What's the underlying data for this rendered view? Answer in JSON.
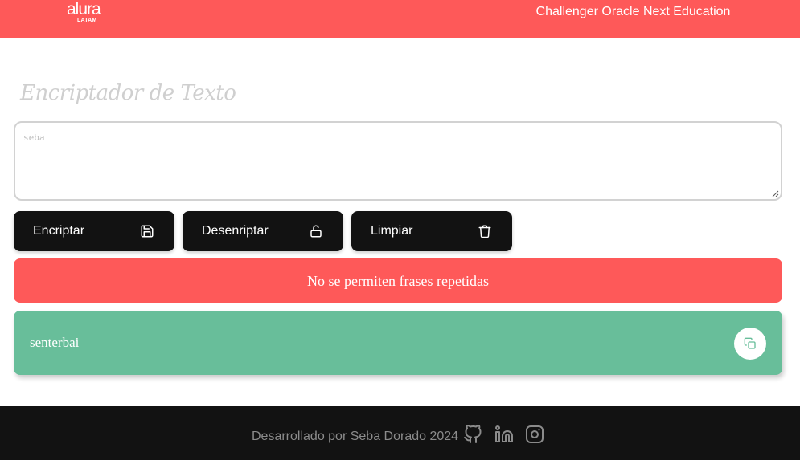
{
  "header": {
    "logo_text": "alura",
    "logo_sub": "LATAM",
    "title": "Challenger Oracle Next Education"
  },
  "main": {
    "title": "Encriptador de Texto",
    "input_value": "seba",
    "buttons": [
      {
        "label": "Encriptar",
        "icon": "save-icon"
      },
      {
        "label": "Desenriptar",
        "icon": "unlock-icon"
      },
      {
        "label": "Limpiar",
        "icon": "trash-icon"
      }
    ],
    "alert": "No se permiten frases repetidas",
    "result": {
      "text": "senterbai",
      "copy_icon": "copy-icon"
    }
  },
  "footer": {
    "credit": "Desarrollado por Seba Dorado 2024",
    "social_icons": [
      "github-icon",
      "linkedin-icon",
      "instagram-icon"
    ]
  },
  "colors": {
    "accent_red": "#fe5959",
    "dark": "#121212",
    "success_green": "#68be9a"
  }
}
